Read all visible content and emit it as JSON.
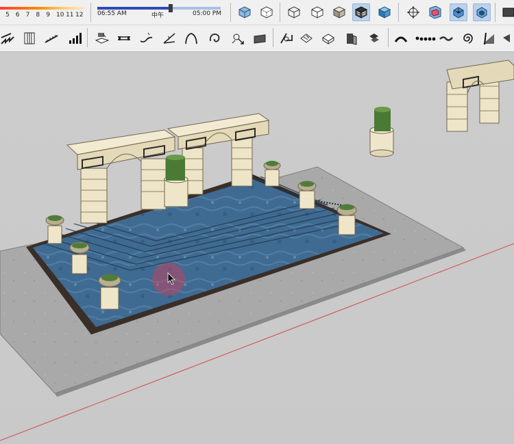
{
  "fog_scale": {
    "ticks": [
      "5",
      "6",
      "7",
      "8",
      "9",
      "10",
      "11",
      "12"
    ]
  },
  "shadow_time": {
    "start_time": "06:55 AM",
    "noon": "中午",
    "end_time": "05:00 PM",
    "morning_fraction": 0.58
  },
  "toolbar_row1": {
    "style_icons": [
      "xray-style-icon",
      "back-edges-style-icon",
      "wireframe-style-icon",
      "hidden-line-style-icon",
      "shaded-style-icon",
      "shaded-textures-style-icon",
      "monochrome-style-icon"
    ],
    "active_style": "shaded-textures-style-icon",
    "section_icons": [
      "section-plane-icon",
      "display-section-planes-icon",
      "display-section-cuts-icon",
      "display-section-fill-icon",
      "partial-icon"
    ],
    "active_section": [
      "display-section-cuts-icon",
      "display-section-fill-icon"
    ]
  },
  "toolbar_row2": {
    "icons": [
      "stairs-icon",
      "column-icon",
      "ramp-icon",
      "stair-bars-icon",
      "push-pull-line-icon",
      "line-dash-icon",
      "curve-tool-icon",
      "arc-angle-icon",
      "split-arrows-icon",
      "curved-arc-icon",
      "rotate-arrow-icon",
      "scale-tool-icon",
      "mirror-plane-icon",
      "eraser-tool-icon",
      "rotate-ring-icon",
      "flip-tool-icon",
      "door-panel-icon",
      "paint-bucket-icon",
      "bridge-arc-icon",
      "dot-path-icon",
      "wave-line-icon",
      "spiral-icon",
      "slope-tool-icon",
      "extra-tool-icon"
    ]
  },
  "scene": {
    "description_tag": "3d-model-viewport",
    "axis_color": "#d24a4a",
    "water_color": "#3f6b92",
    "stone_color": "#eee5c8",
    "ground_color": "#a9a9a9"
  }
}
